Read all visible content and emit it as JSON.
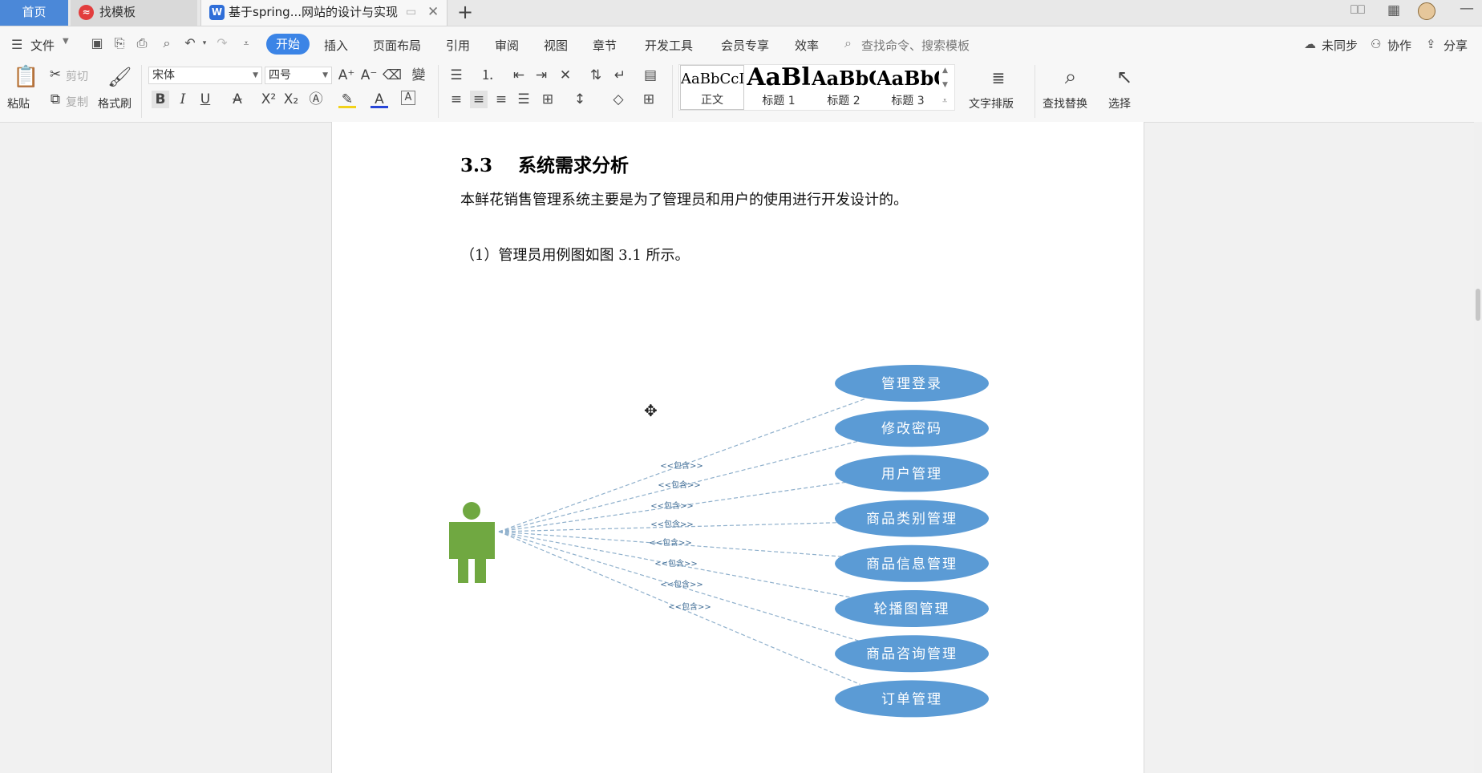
{
  "tabs": {
    "home": "首页",
    "template": "找模板",
    "document": "基于spring...网站的设计与实现"
  },
  "commands": {
    "file": "文件",
    "menus": [
      "开始",
      "插入",
      "页面布局",
      "引用",
      "审阅",
      "视图",
      "章节",
      "开发工具",
      "会员专享",
      "效率"
    ],
    "search_placeholder": "查找命令、搜索模板",
    "sync": "未同步",
    "collab": "协作",
    "share": "分享"
  },
  "ribbon": {
    "paste": "粘贴",
    "cut": "剪切",
    "copy": "复制",
    "format_painter": "格式刷",
    "font_name": "宋体",
    "font_size": "四号",
    "styles": [
      {
        "sample": "AaBbCcI",
        "name": "正文"
      },
      {
        "sample": "AaBl",
        "name": "标题 1"
      },
      {
        "sample": "AaBbC",
        "name": "标题 2"
      },
      {
        "sample": "AaBbC",
        "name": "标题 3"
      }
    ],
    "text_layout": "文字排版",
    "find_replace": "查找替换",
    "select": "选择"
  },
  "document": {
    "heading_number": "3.3",
    "heading_text": "系统需求分析",
    "para1": "本鲜花销售管理系统主要是为了管理员和用户的使用进行开发设计的。",
    "para2": "（1）管理员用例图如图 3.1 所示。",
    "diagram": {
      "relation_label": "<<包含>>",
      "use_cases": [
        "管理登录",
        "修改密码",
        "用户管理",
        "商品类别管理",
        "商品信息管理",
        "轮播图管理",
        "商品咨询管理",
        "订单管理"
      ],
      "actor_color": "#70a841",
      "usecase_color": "#5b9bd5",
      "line_color": "#8fb0cc"
    }
  },
  "colors": {
    "accent": "#3b84e6",
    "home_tab": "#4b88d8"
  }
}
